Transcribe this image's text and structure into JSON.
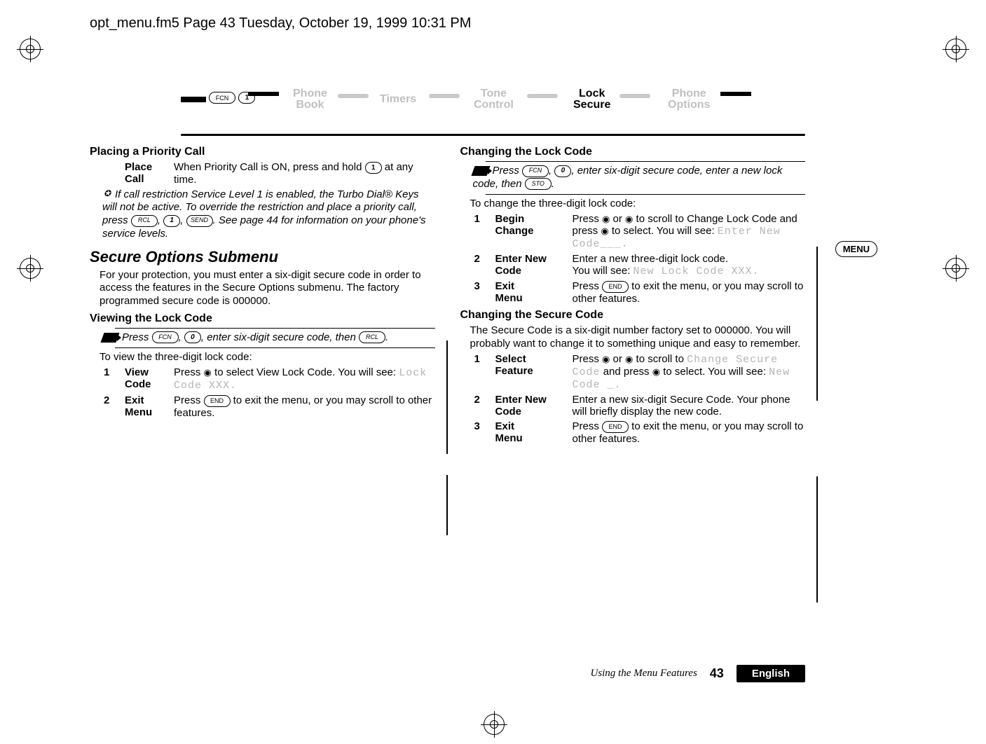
{
  "runhead": "opt_menu.fm5  Page 43  Tuesday, October 19, 1999  10:31 PM",
  "crumbs": {
    "fcn": "FCN",
    "one": "1",
    "phonebook_top": "Phone",
    "phonebook_bot": "Book",
    "timers": "Timers",
    "tone_top": "Tone",
    "tone_bot": "Control",
    "lock_top": "Lock",
    "lock_bot": "Secure",
    "opts_top": "Phone",
    "opts_bot": "Options"
  },
  "left": {
    "h_priority": "Placing a Priority Call",
    "place_lbl_top": "Place",
    "place_lbl_bot": "Call",
    "place_body_a": "When Priority Call is ON, press and hold ",
    "place_body_b": " at any time.",
    "note_body": "If call restriction Service Level 1 is enabled, the Turbo Dial® Keys will not be active. To override the restriction and place a priority call, press ",
    "note_body_tail": ". See page 44 for information on your phone's service levels.",
    "h_secure_submenu": "Secure Options Submenu",
    "secure_para": "For your protection, you must enter a six-digit secure code in order to access the features in the Secure Options submenu. The factory programmed secure code is 000000.",
    "h_viewlock": "Viewing the Lock Code",
    "view_tip_a": "Press ",
    "view_tip_b": ", enter six-digit secure code, then ",
    "view_intro": "To view the three-digit lock code:",
    "step1_lbl_top": "View",
    "step1_lbl_bot": "Code",
    "step1_body_a": "Press ",
    "step1_body_b": " to select View Lock Code. You will see: ",
    "step1_lcd": "Lock Code XXX.",
    "step2_lbl_top": "Exit",
    "step2_lbl_bot": "Menu",
    "step2_body_a": "Press ",
    "step2_body_b": " to exit the menu, or you may scroll to other features."
  },
  "right": {
    "h_changelock": "Changing the Lock Code",
    "tip_a": "Press ",
    "tip_b": ", enter six-digit secure code, enter a new lock code, then ",
    "intro": "To change the three-digit lock code:",
    "s1_lbl_top": "Begin",
    "s1_lbl_bot": "Change",
    "s1_body_a": "Press ",
    "s1_body_b": " or ",
    "s1_body_c": " to scroll to Change Lock Code and press ",
    "s1_body_d": " to select. You will see: ",
    "s1_lcd": "Enter New Code___.",
    "s2_lbl_top": "Enter New",
    "s2_lbl_bot": "Code",
    "s2_body_a": "Enter a new three-digit lock code.",
    "s2_body_b": "You will see: ",
    "s2_lcd": "New Lock Code XXX.",
    "s3_lbl_top": "Exit",
    "s3_lbl_bot": "Menu",
    "s3_body_a": "Press ",
    "s3_body_b": " to exit the menu, or you may scroll to other features.",
    "h_changesecure": "Changing the Secure Code",
    "secure_para": "The Secure Code is a six-digit number factory set to 000000. You will probably want to change it to something unique and easy to remember.",
    "ss1_lbl_top": "Select",
    "ss1_lbl_bot": "Feature",
    "ss1_body_a": "Press ",
    "ss1_body_b": " or ",
    "ss1_body_c": " to scroll to ",
    "ss1_lcd1": "Change Secure Code",
    "ss1_body_d": " and press ",
    "ss1_body_e": " to select. You will see: ",
    "ss1_lcd2": "New Code _.",
    "ss2_lbl_top": "Enter New",
    "ss2_lbl_bot": "Code",
    "ss2_body": "Enter a new six-digit Secure Code. Your phone will briefly display the new code.",
    "ss3_lbl_top": "Exit",
    "ss3_lbl_bot": "Menu",
    "ss3_body_a": "Press ",
    "ss3_body_b": " to exit the menu, or you may scroll to other features."
  },
  "sidebar_menu": "MENU",
  "footer": {
    "using": "Using the Menu Features",
    "page": "43",
    "lang": "English"
  },
  "keys": {
    "fcn": "FCN",
    "rcl": "RCL",
    "sto": "STO",
    "send": "SEND",
    "end": "END",
    "zero": "0",
    "one": "1"
  }
}
